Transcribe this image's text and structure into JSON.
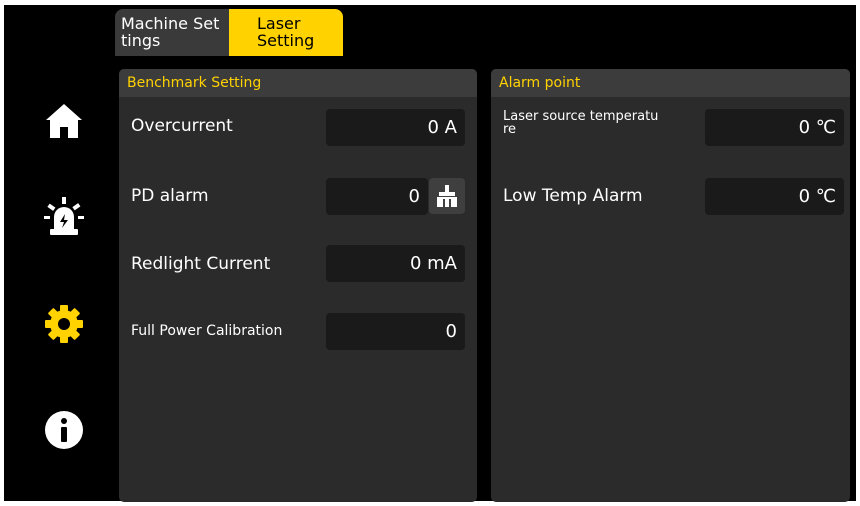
{
  "tabs": {
    "machine_settings": "Machine Set\ntings",
    "laser_setting": "Laser\nSetting"
  },
  "sidebar": {
    "items": [
      {
        "icon": "home-icon"
      },
      {
        "icon": "alarm-icon"
      },
      {
        "icon": "gear-icon"
      },
      {
        "icon": "info-icon"
      }
    ]
  },
  "benchmark": {
    "title": "Benchmark Setting",
    "overcurrent": {
      "label": "Overcurrent",
      "value": "0 A"
    },
    "pd_alarm": {
      "label": "PD alarm",
      "value": "0"
    },
    "redlight_current": {
      "label": "Redlight Current",
      "value": "0 mA"
    },
    "full_power_calibration": {
      "label": "Full Power Calibration",
      "value": "0"
    }
  },
  "alarm": {
    "title": "Alarm point",
    "laser_source_temperature": {
      "label": "Laser source temperatu\nre",
      "value": "0 ℃"
    },
    "low_temp_alarm": {
      "label": "Low Temp Alarm",
      "value": "0 ℃"
    }
  },
  "colors": {
    "accent": "#ffd200",
    "background": "#000000",
    "panel": "#2b2b2b"
  }
}
